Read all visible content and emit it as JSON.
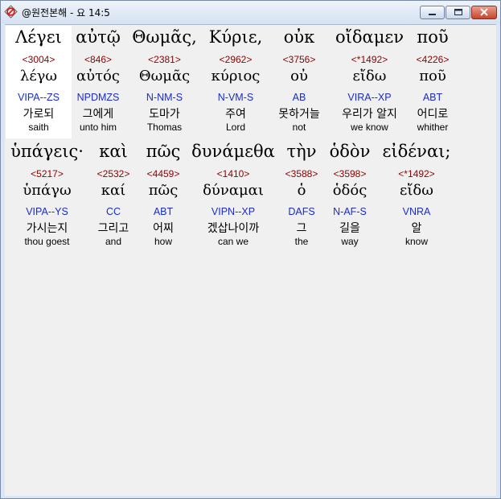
{
  "window": {
    "title": "@원전본해 - 요 14:5",
    "icons": {
      "app": "no-entry-sign-icon",
      "minimize": "minimize-icon",
      "maximize": "maximize-icon",
      "close": "close-icon"
    }
  },
  "rows": [
    [
      {
        "greek": "Λέγει",
        "strong": "<3004>",
        "lemma": "λέγω",
        "parsing": "VIPA--ZS",
        "korean": "가로되",
        "english": "saith"
      },
      {
        "greek": "αὐτῷ",
        "strong": "<846>",
        "lemma": "αὐτός",
        "parsing": "NPDMZS",
        "korean": "그에게",
        "english": "unto him"
      },
      {
        "greek": "Θωμᾶς,",
        "strong": "<2381>",
        "lemma": "Θωμᾶς",
        "parsing": "N-NM-S",
        "korean": "도마가",
        "english": "Thomas"
      },
      {
        "greek": "Κύριε,",
        "strong": "<2962>",
        "lemma": "κύριος",
        "parsing": "N-VM-S",
        "korean": "주여",
        "english": "Lord"
      },
      {
        "greek": "οὐκ",
        "strong": "<3756>",
        "lemma": "οὐ",
        "parsing": "AB",
        "korean": "못하거늘",
        "english": "not"
      },
      {
        "greek": "οἴδαμεν",
        "strong": "<*1492>",
        "lemma": "εἴδω",
        "parsing": "VIRA--XP",
        "korean": "우리가 알지",
        "english": "we know"
      },
      {
        "greek": "ποῦ",
        "strong": "<4226>",
        "lemma": "ποῦ",
        "parsing": "ABT",
        "korean": "어디로",
        "english": "whither"
      }
    ],
    [
      {
        "greek": "ὑπάγεις·",
        "strong": "<5217>",
        "lemma": "ὑπάγω",
        "parsing": "VIPA--YS",
        "korean": "가시는지",
        "english": "thou goest"
      },
      {
        "greek": "καὶ",
        "strong": "<2532>",
        "lemma": "καί",
        "parsing": "CC",
        "korean": "그리고",
        "english": "and"
      },
      {
        "greek": "πῶς",
        "strong": "<4459>",
        "lemma": "πῶς",
        "parsing": "ABT",
        "korean": "어찌",
        "english": "how"
      },
      {
        "greek": "δυνάμεθα",
        "strong": "<1410>",
        "lemma": "δύναμαι",
        "parsing": "VIPN--XP",
        "korean": "겠삽나이까",
        "english": "can we"
      },
      {
        "greek": "τὴν",
        "strong": "<3588>",
        "lemma": "ὁ",
        "parsing": "DAFS",
        "korean": "그",
        "english": "the"
      },
      {
        "greek": "ὁδὸν",
        "strong": "<3598>",
        "lemma": "ὁδός",
        "parsing": "N-AF-S",
        "korean": "길을",
        "english": "way"
      },
      {
        "greek": "εἰδέναι;",
        "strong": "<*1492>",
        "lemma": "εἴδω",
        "parsing": "VNRA",
        "korean": "알",
        "english": "know"
      }
    ]
  ]
}
